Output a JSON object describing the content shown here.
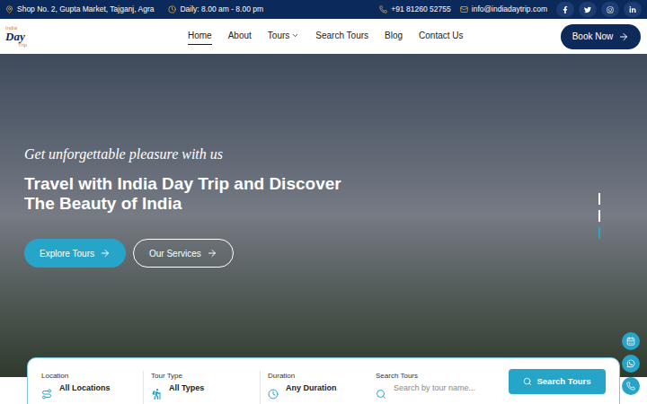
{
  "topbar": {
    "address": "Shop No. 2, Gupta Market, Tajganj, Agra",
    "hours": "Daily: 8.00 am - 8.00 pm",
    "phone": "+91 81260 52755",
    "email": "info@indiadaytrip.com"
  },
  "logo": {
    "top": "India",
    "main": "Day",
    "bottom": "Trip"
  },
  "nav": [
    {
      "label": "Home",
      "selected": true,
      "has_menu": false
    },
    {
      "label": "About",
      "selected": false,
      "has_menu": false
    },
    {
      "label": "Tours",
      "selected": false,
      "has_menu": true
    },
    {
      "label": "Search Tours",
      "selected": false,
      "has_menu": false
    },
    {
      "label": "Blog",
      "selected": false,
      "has_menu": false
    },
    {
      "label": "Contact Us",
      "selected": false,
      "has_menu": false
    }
  ],
  "book_button": "Book Now",
  "hero": {
    "tagline": "Get unforgettable pleasure with us",
    "title": [
      "Travel with India Day Trip and Discover",
      "The Beauty of India"
    ],
    "buttons": [
      {
        "label": "Explore Tours",
        "kind": "primary"
      },
      {
        "label": "Our Services",
        "kind": "outline"
      }
    ]
  },
  "slides": [
    {
      "selected": false
    },
    {
      "selected": false
    },
    {
      "selected": true
    }
  ],
  "search": {
    "fields": [
      {
        "label": "Location",
        "value": "All Locations",
        "kind": "select"
      },
      {
        "label": "Tour Type",
        "value": "All Types",
        "kind": "select"
      },
      {
        "label": "Duration",
        "value": "Any Duration",
        "kind": "select"
      },
      {
        "label": "Search Tours",
        "placeholder": "Search by tour name...",
        "kind": "input"
      }
    ],
    "button": "Search Tours"
  }
}
